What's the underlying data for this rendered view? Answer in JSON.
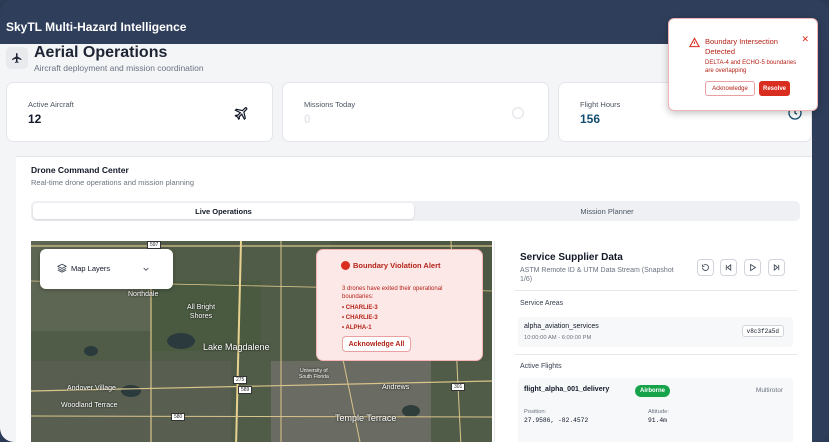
{
  "app": {
    "title": "SkyTL Multi-Hazard Intelligence"
  },
  "header": {
    "title": "Aerial Operations",
    "subtitle": "Aircraft deployment and mission coordination"
  },
  "stats": [
    {
      "label": "Active Aircraft",
      "value": "12",
      "icon": "plane-icon"
    },
    {
      "label": "Missions Today",
      "value": "0",
      "icon": "target-icon"
    },
    {
      "label": "Flight Hours",
      "value": "156",
      "icon": "clock-icon"
    }
  ],
  "command": {
    "title": "Drone Command Center",
    "subtitle": "Real-time drone operations and mission planning",
    "tabs": [
      {
        "label": "Live Operations",
        "active": true
      },
      {
        "label": "Mission Planner",
        "active": false
      }
    ]
  },
  "map": {
    "layers_label": "Map Layers",
    "labels": {
      "northdale": "Northdale",
      "all_bright_shores": "All Bright\nShores",
      "lake_magdalene": "Lake Magdalene",
      "andover_village": "Andover Village",
      "woodland_terrace": "Woodland Terrace",
      "andrews": "Andrews",
      "temple_terrace": "Temple Terrace",
      "university": "University of\nSouth Florida"
    },
    "shields": [
      "597",
      "589",
      "275",
      "580",
      "301",
      "580"
    ],
    "alert": {
      "title": "Boundary Violation Alert",
      "message": "3 drones have exited their operational boundaries:",
      "items": [
        "• CHARLIE-3",
        "• CHARLIE-3",
        "• ALPHA-1"
      ],
      "button": "Acknowledge All"
    }
  },
  "supplier": {
    "title": "Service Supplier Data",
    "subtitle": "ASTM Remote ID & UTM Data Stream (Snapshot 1/6)",
    "service_areas_label": "Service Areas",
    "service": {
      "name": "alpha_aviation_services",
      "time": "10:00:00 AM - 6:00:00 PM",
      "id": "v8c3f2a5d"
    },
    "active_flights_label": "Active Flights",
    "flight": {
      "name": "flight_alpha_001_delivery",
      "status": "Airborne",
      "type": "Multirotor",
      "position_label": "Position:",
      "position": "27.9586, -82.4572",
      "altitude_label": "Altitude:",
      "altitude": "91.4m"
    }
  },
  "toast": {
    "title": "Boundary Intersection Detected",
    "message": "DELTA-4 and ECHO-5 boundaries are overlapping",
    "acknowledge": "Acknowledge",
    "resolve": "Resolve"
  },
  "colors": {
    "accent_red": "#d92d20",
    "airborne_green": "#16a34a",
    "topbar": "#2f3e5b"
  }
}
